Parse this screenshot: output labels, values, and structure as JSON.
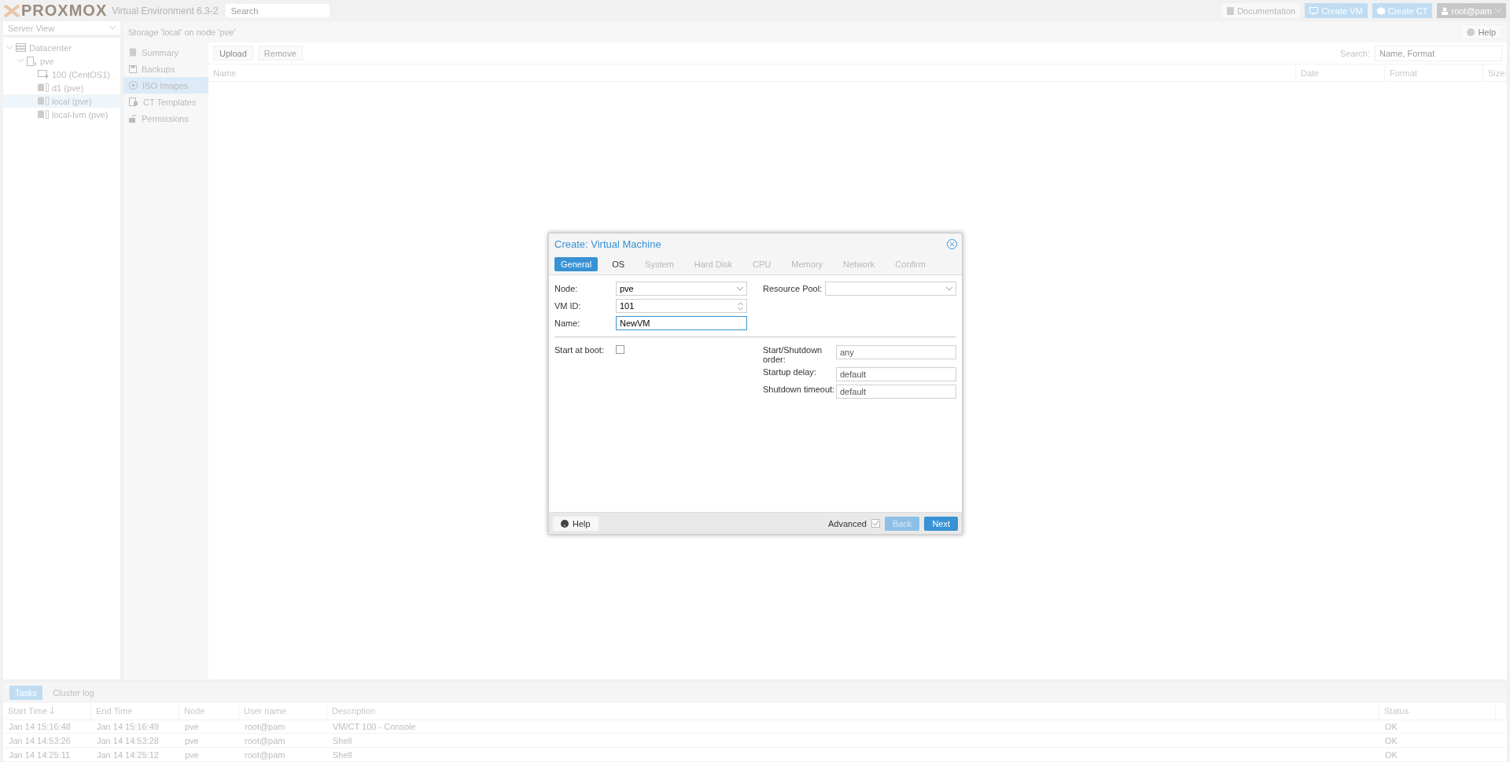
{
  "header": {
    "logo": "PROXMOX",
    "version": "Virtual Environment 6.3-2",
    "search_placeholder": "Search",
    "buttons": [
      {
        "kind": "doc",
        "label": "Documentation"
      },
      {
        "kind": "vm",
        "label": "Create VM"
      },
      {
        "kind": "ct",
        "label": "Create CT"
      }
    ],
    "user": "root@pam"
  },
  "sidebar": {
    "view": "Server View",
    "tree": [
      {
        "label": "Datacenter",
        "kind": "datacenter",
        "selected": false,
        "children": [
          {
            "label": "pve",
            "kind": "node",
            "selected": false,
            "children": [
              {
                "label": "100 (CentOS1)",
                "kind": "vm",
                "selected": false
              },
              {
                "label": "d1 (pve)",
                "kind": "storage",
                "selected": false
              },
              {
                "label": "local (pve)",
                "kind": "storage",
                "selected": true
              },
              {
                "label": "local-lvm (pve)",
                "kind": "storage",
                "selected": false
              }
            ]
          }
        ]
      }
    ]
  },
  "content": {
    "title": "Storage 'local' on node 'pve'",
    "help": "Help",
    "nav": [
      {
        "label": "Summary",
        "kind": "summary",
        "selected": false
      },
      {
        "label": "Backups",
        "kind": "backups",
        "selected": false
      },
      {
        "label": "ISO Images",
        "kind": "iso",
        "selected": true
      },
      {
        "label": "CT Templates",
        "kind": "templates",
        "selected": false
      },
      {
        "label": "Permissions",
        "kind": "permissions",
        "selected": false
      }
    ],
    "toolbar": [
      {
        "label": "Upload",
        "disabled": false
      },
      {
        "label": "Remove",
        "disabled": true
      }
    ],
    "search_label": "Search:",
    "search_placeholder": "Name, Format",
    "columns": [
      "Name",
      "Date",
      "Format",
      "Size"
    ]
  },
  "dialog": {
    "title": "Create: Virtual Machine",
    "tabs": [
      {
        "label": "General",
        "selected": true,
        "disabled": false
      },
      {
        "label": "OS",
        "selected": false,
        "disabled": false
      },
      {
        "label": "System",
        "selected": false,
        "disabled": true
      },
      {
        "label": "Hard Disk",
        "selected": false,
        "disabled": true
      },
      {
        "label": "CPU",
        "selected": false,
        "disabled": true
      },
      {
        "label": "Memory",
        "selected": false,
        "disabled": true
      },
      {
        "label": "Network",
        "selected": false,
        "disabled": true
      },
      {
        "label": "Confirm",
        "selected": false,
        "disabled": true
      }
    ],
    "left_fields": [
      {
        "kind": "select",
        "label": "Node:",
        "value": "pve"
      },
      {
        "kind": "spinner",
        "label": "VM ID:",
        "value": "101"
      },
      {
        "kind": "text",
        "label": "Name:",
        "value": "NewVM"
      }
    ],
    "right_fields": [
      {
        "kind": "select",
        "label": "Resource Pool:"
      }
    ],
    "start_at_boot": {
      "label": "Start at boot:",
      "checked": false
    },
    "order_fields": [
      {
        "label": "Start/Shutdown order:",
        "placeholder": "any"
      },
      {
        "label": "Startup delay:",
        "placeholder": "default"
      },
      {
        "label": "Shutdown timeout:",
        "placeholder": "default"
      }
    ],
    "help": "Help",
    "advanced": {
      "label": "Advanced",
      "checked": true
    },
    "back": {
      "label": "Back",
      "disabled": true
    },
    "next": {
      "label": "Next",
      "disabled": false
    }
  },
  "tasks": {
    "tabs": [
      {
        "label": "Tasks",
        "selected": true
      },
      {
        "label": "Cluster log",
        "selected": false
      }
    ],
    "columns": [
      {
        "label": "Start Time",
        "sorted": true
      },
      {
        "label": "End Time",
        "sorted": false
      },
      {
        "label": "Node",
        "sorted": false
      },
      {
        "label": "User name",
        "sorted": false
      },
      {
        "label": "Description",
        "sorted": false
      },
      {
        "label": "Status",
        "sorted": false
      }
    ],
    "rows": [
      [
        "Jan 14 15:16:48",
        "Jan 14 15:16:49",
        "pve",
        "root@pam",
        "VM/CT 100 - Console",
        "OK"
      ],
      [
        "Jan 14 14:53:26",
        "Jan 14 14:53:28",
        "pve",
        "root@pam",
        "Shell",
        "OK"
      ],
      [
        "Jan 14 14:25:11",
        "Jan 14 14:25:12",
        "pve",
        "root@pam",
        "Shell",
        "OK"
      ]
    ]
  }
}
